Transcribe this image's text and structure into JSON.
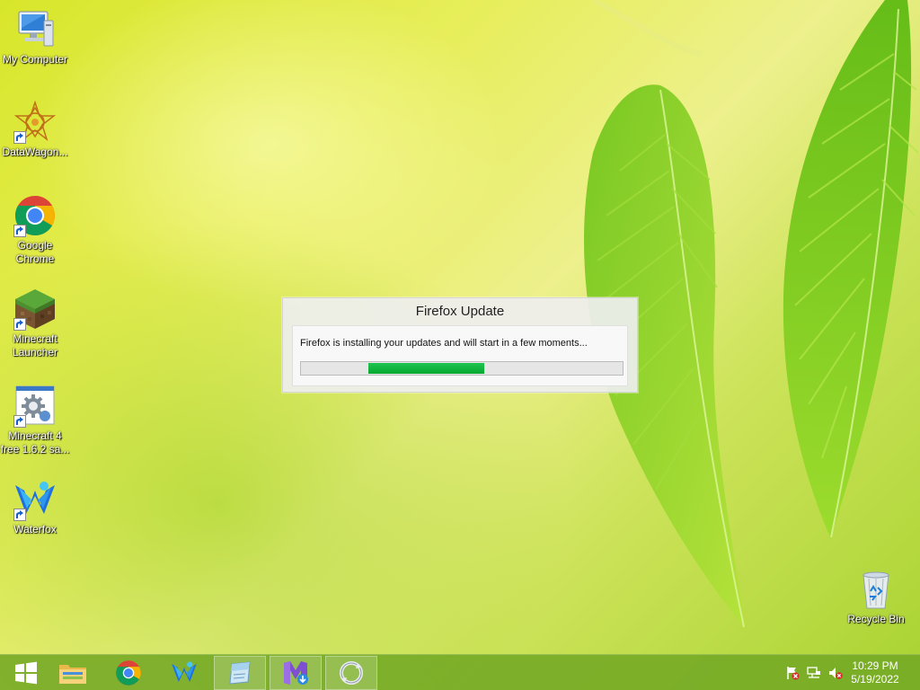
{
  "desktop": {
    "icons": [
      {
        "label": "My Computer",
        "icon": "computer-icon"
      },
      {
        "label": "DataWagon...",
        "icon": "datawagon-icon"
      },
      {
        "label": "Google Chrome",
        "icon": "chrome-icon"
      },
      {
        "label": "Minecraft Launcher",
        "icon": "minecraft-icon"
      },
      {
        "label": "Minecraft 4 free 1.6.2 sa...",
        "icon": "installer-icon"
      },
      {
        "label": "Waterfox",
        "icon": "waterfox-icon"
      },
      {
        "label": "Recycle Bin",
        "icon": "recycle-bin-icon"
      }
    ]
  },
  "dialog": {
    "title": "Firefox Update",
    "message": "Firefox is installing your updates and will start in a few moments...",
    "progress": {
      "start_fraction": 0.21,
      "end_fraction": 0.57,
      "color": "#0bb03a",
      "mode": "indeterminate"
    }
  },
  "taskbar": {
    "buttons": [
      {
        "icon": "windows-start-icon"
      },
      {
        "icon": "file-explorer-icon"
      },
      {
        "icon": "chrome-icon"
      },
      {
        "icon": "waterfox-icon"
      },
      {
        "icon": "notepad-icon",
        "active": true
      },
      {
        "icon": "installer-app-icon",
        "active": true
      },
      {
        "icon": "sync-icon",
        "active": true
      }
    ],
    "tray": {
      "icons": [
        "action-center-flag-icon",
        "network-icon",
        "volume-muted-icon"
      ],
      "time": "10:29 PM",
      "date": "5/19/2022"
    }
  },
  "colors": {
    "accent_green": "#0bb03a",
    "taskbar": "#76aa26"
  }
}
